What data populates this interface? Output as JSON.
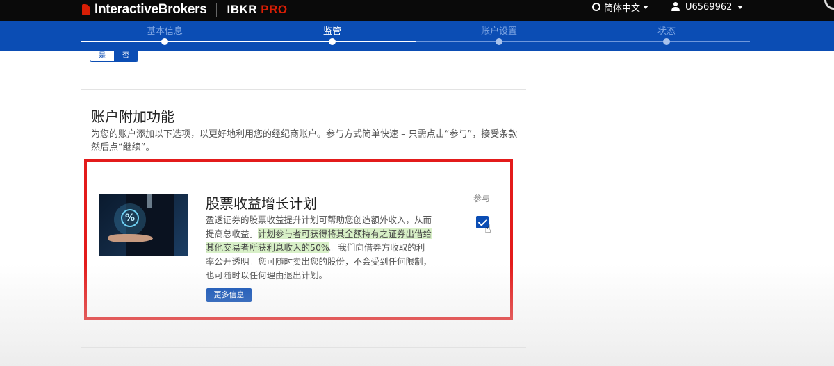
{
  "topbar": {
    "brand_name": "InteractiveBrokers",
    "product_prefix": "IBKR ",
    "product_suffix": "PRO",
    "language": "简体中文",
    "account_id": "U6569962"
  },
  "progress": {
    "steps": [
      {
        "label": "基本信息",
        "state": "done"
      },
      {
        "label": "监管",
        "state": "current"
      },
      {
        "label": "账户设置",
        "state": "todo"
      },
      {
        "label": "状态",
        "state": "todo"
      }
    ],
    "completed_fraction": 0.5
  },
  "toggle": {
    "yes": "是",
    "no": "否",
    "selected": "no"
  },
  "section": {
    "title": "账户附加功能",
    "description": "为您的账户添加以下选项，以更好地利用您的经纪商账户。参与方式简单快速 – 只需点击“参与”，接受条款然后点“继续”。"
  },
  "card": {
    "image_icon": "percent-icon",
    "title": "股票收益增长计划",
    "text_part1": "盈透证券的股票收益提升计划可帮助您创造额外收入，从而提高总收益。",
    "text_highlight": "计划参与者可获得将其全额持有之证券出借给其他交易者所获利息收入的50%",
    "text_part2": "。我们向借券方收取的利率公开透明。您可随时卖出您的股份，不会受到任何限制，也可随时以任何理由退出计划。",
    "more_button": "更多信息",
    "join_label": "参与",
    "joined": true
  },
  "colors": {
    "brand_blue": "#0b4db4",
    "brand_red": "#d81e05",
    "highlight_box": "#e31b1b",
    "highlight_text_bg": "#d8f0c7"
  }
}
